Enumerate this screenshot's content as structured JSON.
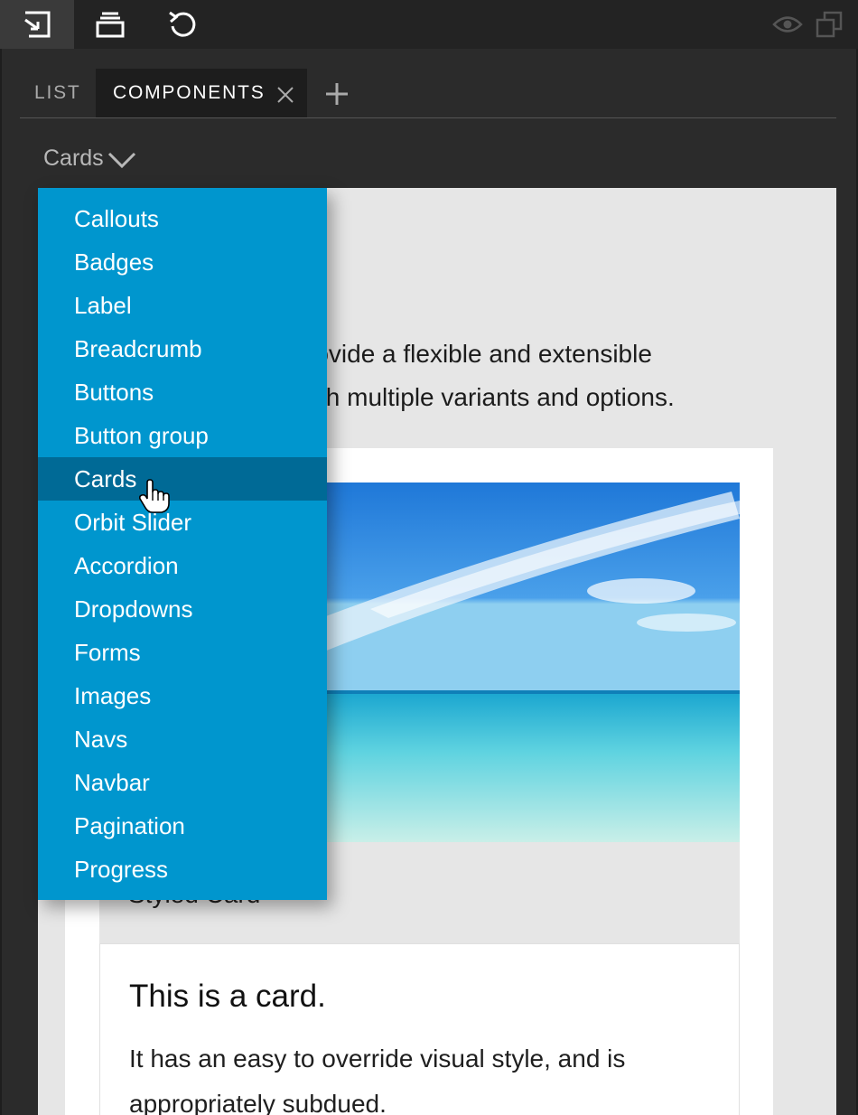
{
  "toolbar": {
    "buttons": [
      {
        "icon": "export-icon",
        "active": true
      },
      {
        "icon": "archive-icon",
        "active": false
      },
      {
        "icon": "refresh-icon",
        "active": false
      }
    ],
    "right_icons": [
      "eye-icon",
      "windows-icon"
    ]
  },
  "tabs": {
    "list_label": "LIST",
    "components_label": "COMPONENTS",
    "close_icon": "close-icon",
    "add_icon": "plus-icon"
  },
  "category": {
    "selected": "Cards",
    "icon": "chevron-down-icon"
  },
  "menu": {
    "items": [
      "Callouts",
      "Badges",
      "Label",
      "Breadcrumb",
      "Buttons",
      "Button group",
      "Cards",
      "Orbit Slider",
      "Accordion",
      "Dropdowns",
      "Forms",
      "Images",
      "Navs",
      "Navbar",
      "Pagination",
      "Progress"
    ],
    "selected_index": 6,
    "background_color": "#0096ce",
    "selected_color": "#006a96"
  },
  "preview": {
    "intro_line1": "rovide a flexible and extensible",
    "intro_line2": "th multiple variants and options.",
    "card_caption": "Styled Card",
    "card_title": "This is a card.",
    "card_text": "It has an easy to override visual style, and is appropriately subdued."
  }
}
